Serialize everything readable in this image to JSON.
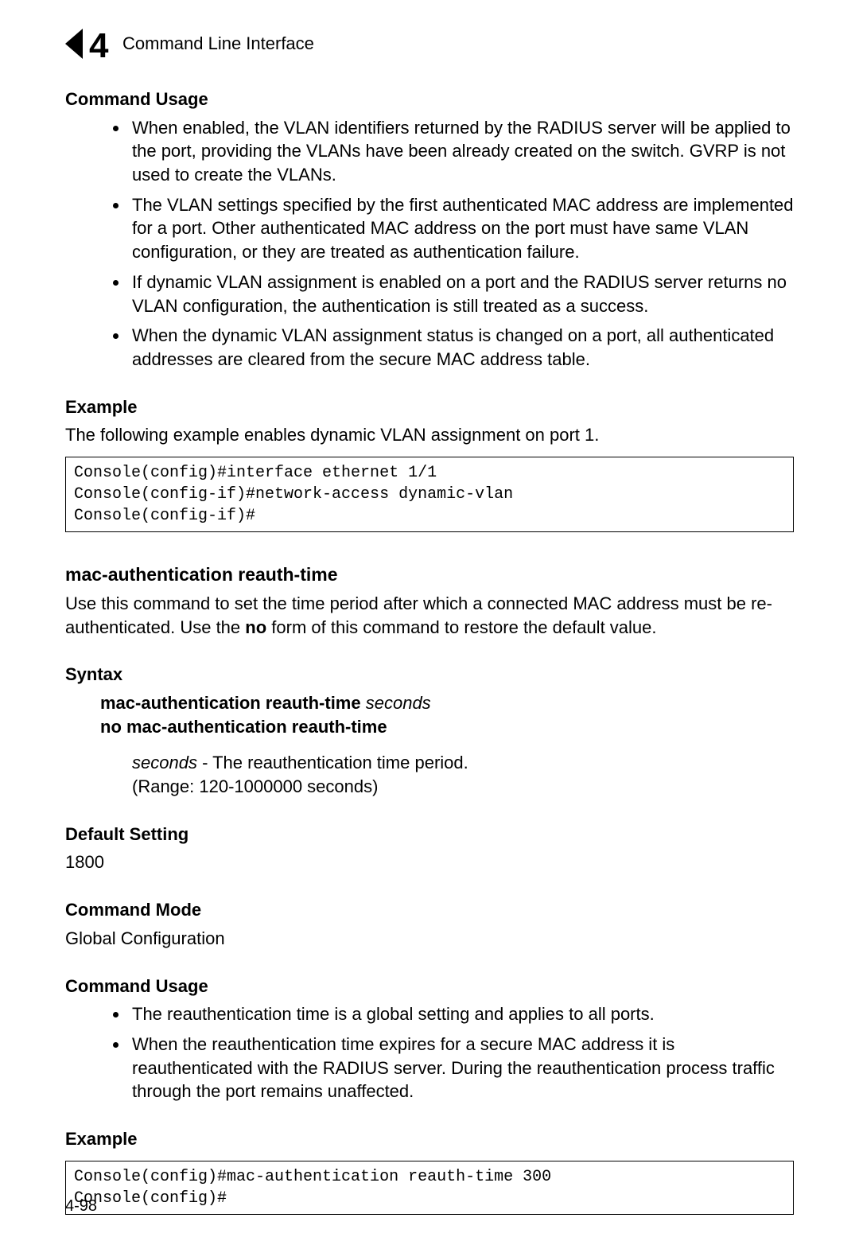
{
  "header": {
    "chapter_number": "4",
    "title": "Command Line Interface"
  },
  "page_number": "4-98",
  "section1": {
    "heading_usage": "Command Usage",
    "bullets_usage": [
      "When enabled, the VLAN identifiers returned by the RADIUS server will be applied to the port, providing the VLANs have been already created on the switch. GVRP is not used to create the VLANs.",
      "The VLAN settings specified by the first authenticated MAC address are implemented for a port. Other authenticated MAC address on the port must have same VLAN configuration, or they are treated as authentication failure.",
      "If dynamic VLAN assignment is enabled on a port and the RADIUS server returns no VLAN configuration, the authentication is still treated as a success.",
      "When the dynamic VLAN assignment status is changed on a port, all authenticated addresses are cleared from the secure MAC address table."
    ],
    "heading_example": "Example",
    "example_intro": "The following example enables dynamic VLAN assignment on port 1.",
    "example_code": "Console(config)#interface ethernet 1/1\nConsole(config-if)#network-access dynamic-vlan\nConsole(config-if)#"
  },
  "section2": {
    "title": "mac-authentication reauth-time",
    "desc_pre": "Use this command to set the time period after which a connected MAC address must be re-authenticated. Use the ",
    "desc_bold": "no",
    "desc_post": " form of this command to restore the default value.",
    "heading_syntax": "Syntax",
    "syntax_cmd": "mac-authentication reauth-time",
    "syntax_param": "seconds",
    "syntax_no": "no mac-authentication reauth-time",
    "param_name": "seconds",
    "param_desc": " - The reauthentication time period.",
    "param_range": "(Range: 120-1000000 seconds)",
    "heading_default": "Default Setting",
    "default_value": "1800",
    "heading_mode": "Command Mode",
    "mode_value": "Global Configuration",
    "heading_usage": "Command Usage",
    "bullets_usage": [
      "The reauthentication time is a global setting and applies to all ports.",
      "When the reauthentication time expires for a secure MAC address it is reauthenticated with the RADIUS server. During the reauthentication process traffic through the port remains unaffected."
    ],
    "heading_example": "Example",
    "example_code": "Console(config)#mac-authentication reauth-time 300\nConsole(config)#"
  }
}
